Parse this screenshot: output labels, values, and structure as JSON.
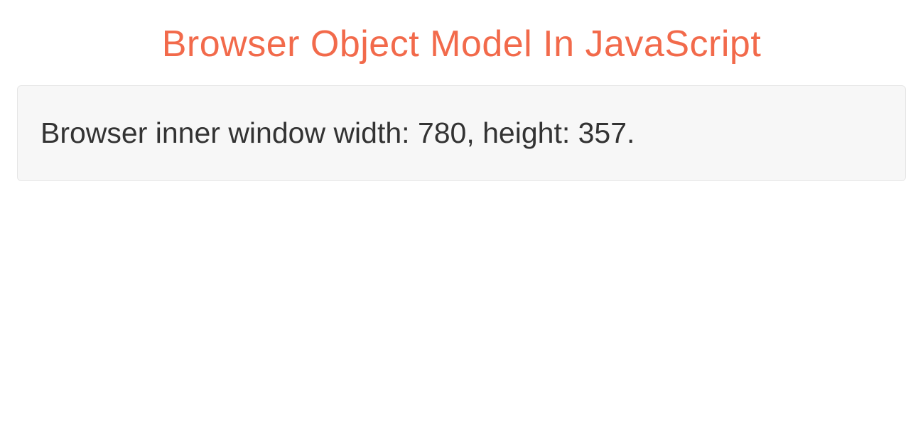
{
  "header": {
    "title": "Browser Object Model In JavaScript"
  },
  "panel": {
    "message": "Browser inner window width: 780, height: 357."
  }
}
